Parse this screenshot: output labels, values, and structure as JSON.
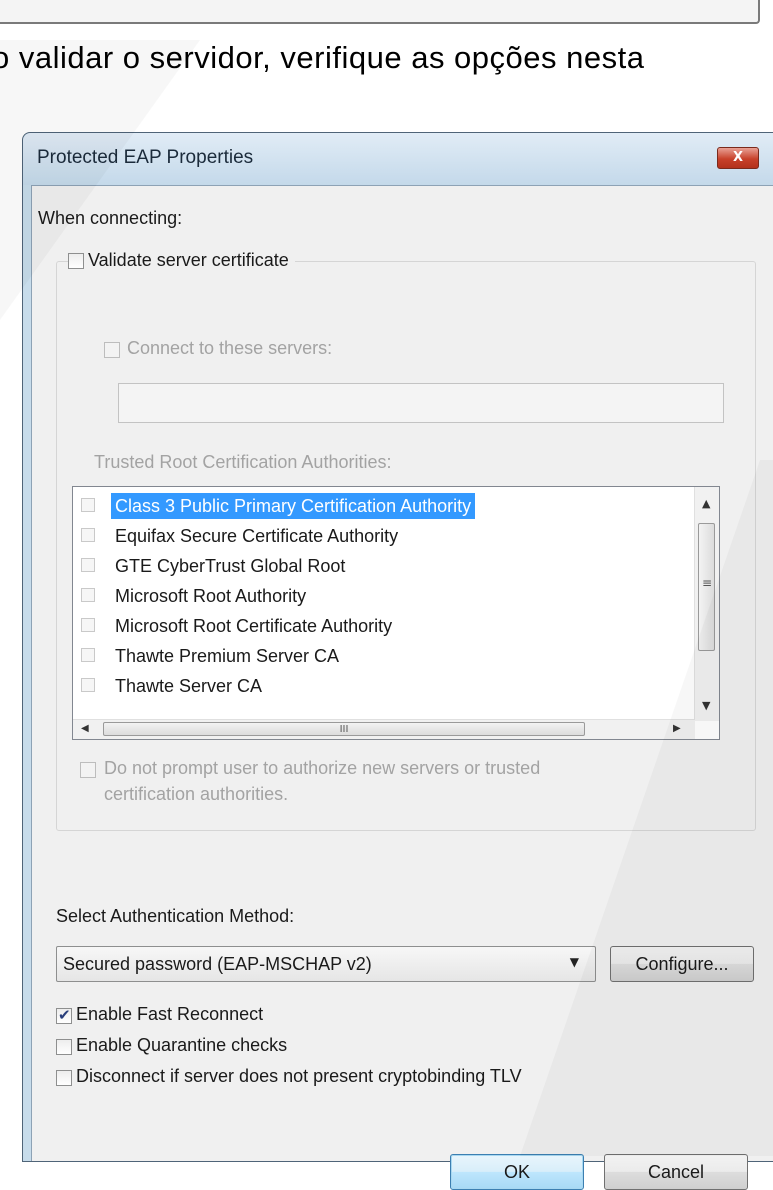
{
  "page": {
    "caption_text": "o validar o servidor, verifique as opções nesta"
  },
  "dialog": {
    "title": "Protected EAP Properties",
    "close_label": "X",
    "when_connecting_label": "When connecting:",
    "validate_server_certificate": {
      "label": "Validate server certificate",
      "checked": false
    },
    "connect_to_servers": {
      "label": "Connect to these servers:",
      "checked": false,
      "enabled": false,
      "value": ""
    },
    "trusted_root_label": "Trusted Root Certification Authorities:",
    "trusted_root_items": [
      {
        "label": "Class 3 Public Primary Certification Authority",
        "checked": false,
        "selected": true
      },
      {
        "label": "Equifax Secure Certificate Authority",
        "checked": false,
        "selected": false
      },
      {
        "label": "GTE CyberTrust Global Root",
        "checked": false,
        "selected": false
      },
      {
        "label": "Microsoft Root Authority",
        "checked": false,
        "selected": false
      },
      {
        "label": "Microsoft Root Certificate Authority",
        "checked": false,
        "selected": false
      },
      {
        "label": "Thawte Premium Server CA",
        "checked": false,
        "selected": false
      },
      {
        "label": "Thawte Server CA",
        "checked": false,
        "selected": false
      }
    ],
    "scroll_grip_vertical": "≡",
    "scroll_grip_horizontal": "III",
    "do_not_prompt": {
      "line1": "Do not prompt user to authorize new servers or trusted",
      "line2": "certification authorities.",
      "checked": false,
      "enabled": false
    },
    "select_auth_method_label": "Select Authentication Method:",
    "auth_method_selected": "Secured password (EAP-MSCHAP v2)",
    "configure_label": "Configure...",
    "enable_fast_reconnect": {
      "label": "Enable Fast Reconnect",
      "checked": true
    },
    "enable_quarantine_checks": {
      "label": "Enable Quarantine checks",
      "checked": false
    },
    "disconnect_cryptobinding": {
      "label": "Disconnect if server does not present cryptobinding TLV",
      "checked": false
    },
    "ok_label": "OK",
    "cancel_label": "Cancel"
  }
}
